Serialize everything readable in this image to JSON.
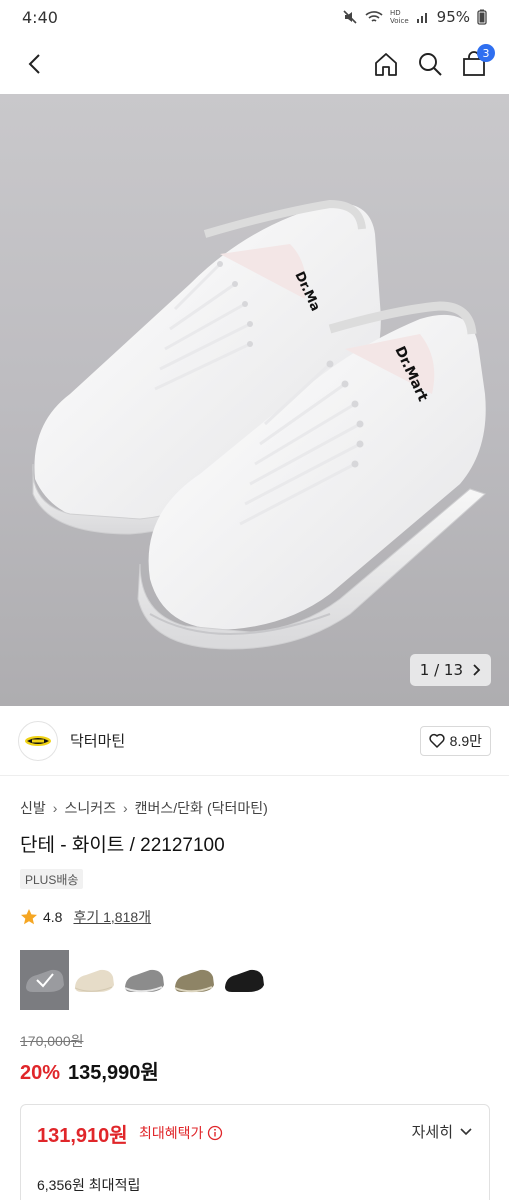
{
  "status_bar": {
    "time": "4:40",
    "battery": "95%",
    "hd_label": "HD",
    "voice_label": "Voice"
  },
  "header": {
    "cart_count": "3"
  },
  "gallery": {
    "counter": "1 / 13"
  },
  "brand": {
    "name": "닥터마틴",
    "likes": "8.9만"
  },
  "product": {
    "breadcrumb": [
      "신발",
      "스니커즈",
      "캔버스/단화",
      "(닥터마틴)"
    ],
    "title": "단테 - 화이트 / 22127100",
    "delivery_badge": "PLUS배송",
    "rating": "4.8",
    "reviews": "후기 1,818개",
    "original_price": "170,000원",
    "discount": "20%",
    "sale_price": "135,990원"
  },
  "variants": [
    {
      "color": "#8a8b8f",
      "selected": true
    },
    {
      "color": "#e6dcc8",
      "selected": false
    },
    {
      "color": "#8c8c8c",
      "selected": false
    },
    {
      "color": "#8e8466",
      "selected": false
    },
    {
      "color": "#1b1b1b",
      "selected": false
    }
  ],
  "benefit": {
    "max_price": "131,910원",
    "max_price_label": "최대혜택가",
    "detail_label": "자세히",
    "points": "6,356원 최대적립"
  },
  "colors": {
    "accent_red": "#e0262a",
    "badge_blue": "#2f6ff0"
  }
}
